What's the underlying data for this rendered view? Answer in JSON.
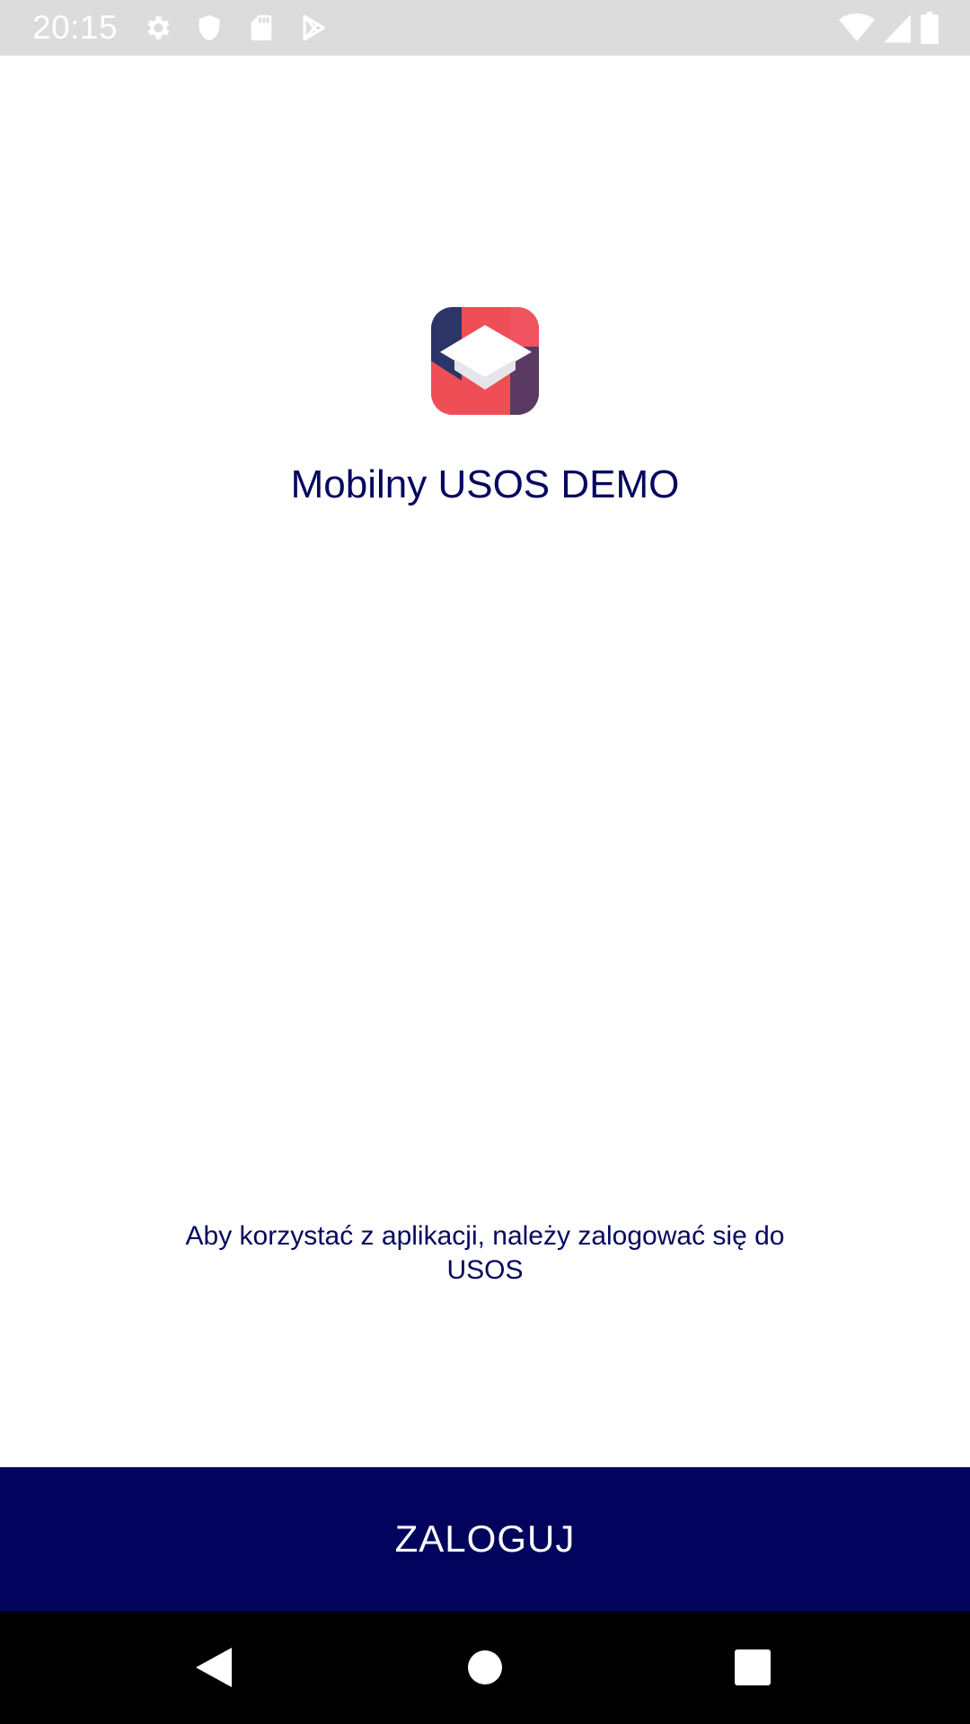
{
  "status_bar": {
    "time": "20:15",
    "left_icons": [
      "gear-icon",
      "shield-icon",
      "sd-card-icon",
      "play-store-icon"
    ],
    "right_icons": [
      "wifi-icon",
      "cell-signal-icon",
      "battery-icon"
    ]
  },
  "app": {
    "logo_icon": "mortarboard-logo",
    "title": "Mobilny USOS DEMO",
    "login_hint": "Aby korzystać z aplikacji, należy zalogować się do USOS",
    "login_button_label": "ZALOGUJ"
  },
  "nav_bar": {
    "buttons": [
      "back-icon",
      "home-icon",
      "recents-icon"
    ]
  },
  "colors": {
    "text_primary": "#05085e",
    "button_background": "#02035d",
    "button_text": "#ffffff",
    "status_bar_background": "#dcdcdc",
    "nav_bar_background": "#000000",
    "logo_red": "#f04e57",
    "logo_navy": "#2c3567"
  }
}
